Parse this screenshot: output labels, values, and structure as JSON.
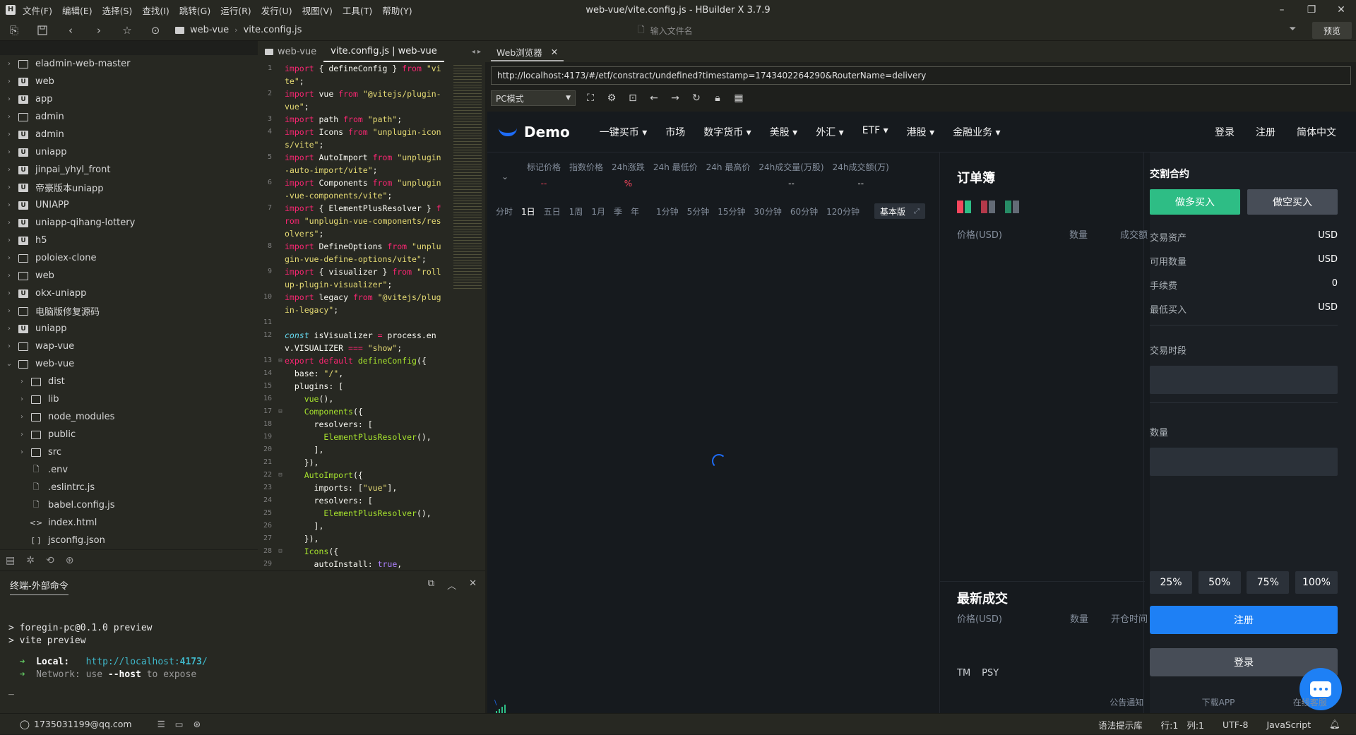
{
  "titlebar": {
    "logo": "H",
    "menu": [
      "文件(F)",
      "编辑(E)",
      "选择(S)",
      "查找(I)",
      "跳转(G)",
      "运行(R)",
      "发行(U)",
      "视图(V)",
      "工具(T)",
      "帮助(Y)"
    ],
    "title": "web-vue/vite.config.js - HBuilder X 3.7.9",
    "controls": {
      "minimize": "–",
      "restore": "❐",
      "close": "✕"
    }
  },
  "toolbar": {
    "breadcrumb": [
      "web-vue",
      "vite.config.js"
    ],
    "file_search_placeholder": "输入文件名",
    "preview_label": "预览"
  },
  "tree": {
    "items": [
      {
        "label": "eladmin-web-master",
        "type": "folder",
        "depth": 0,
        "expanded": false
      },
      {
        "label": "web",
        "type": "project",
        "depth": 0,
        "expanded": false
      },
      {
        "label": "app",
        "type": "project",
        "depth": 0,
        "expanded": false
      },
      {
        "label": "admin",
        "type": "folder",
        "depth": 0,
        "expanded": false
      },
      {
        "label": "admin",
        "type": "project",
        "depth": 0,
        "expanded": false
      },
      {
        "label": "uniapp",
        "type": "project",
        "depth": 0,
        "expanded": false
      },
      {
        "label": "jinpai_yhyl_front",
        "type": "project",
        "depth": 0,
        "expanded": false
      },
      {
        "label": "帝豪版本uniapp",
        "type": "project",
        "depth": 0,
        "expanded": false
      },
      {
        "label": "UNIAPP",
        "type": "project",
        "depth": 0,
        "expanded": false
      },
      {
        "label": "uniapp-qihang-lottery",
        "type": "project",
        "depth": 0,
        "expanded": false
      },
      {
        "label": "h5",
        "type": "project",
        "depth": 0,
        "expanded": false
      },
      {
        "label": "poloiex-clone",
        "type": "folder",
        "depth": 0,
        "expanded": false
      },
      {
        "label": "web",
        "type": "folder",
        "depth": 0,
        "expanded": false
      },
      {
        "label": "okx-uniapp",
        "type": "project",
        "depth": 0,
        "expanded": false
      },
      {
        "label": "电脑版修复源码",
        "type": "folder",
        "depth": 0,
        "expanded": false
      },
      {
        "label": "uniapp",
        "type": "project",
        "depth": 0,
        "expanded": false
      },
      {
        "label": "wap-vue",
        "type": "folder",
        "depth": 0,
        "expanded": false
      },
      {
        "label": "web-vue",
        "type": "folder",
        "depth": 0,
        "expanded": true
      },
      {
        "label": "dist",
        "type": "folder",
        "depth": 1,
        "expanded": false
      },
      {
        "label": "lib",
        "type": "folder",
        "depth": 1,
        "expanded": false
      },
      {
        "label": "node_modules",
        "type": "folder",
        "depth": 1,
        "expanded": false
      },
      {
        "label": "public",
        "type": "folder",
        "depth": 1,
        "expanded": false
      },
      {
        "label": "src",
        "type": "folder",
        "depth": 1,
        "expanded": false
      },
      {
        "label": ".env",
        "type": "file",
        "depth": 1
      },
      {
        "label": ".eslintrc.js",
        "type": "file",
        "depth": 1
      },
      {
        "label": "babel.config.js",
        "type": "file",
        "depth": 1
      },
      {
        "label": "index.html",
        "type": "html",
        "depth": 1
      },
      {
        "label": "jsconfig.json",
        "type": "json",
        "depth": 1
      }
    ]
  },
  "editor": {
    "tabs": [
      {
        "label": "web-vue",
        "active": false
      },
      {
        "label": "vite.config.js | web-vue",
        "active": true
      }
    ],
    "lines": [
      {
        "n": "1",
        "fold": "",
        "html": "<span class=\"kw\">import</span> { defineConfig } <span class=\"kw\">from</span> <span class=\"str\">\"vite\"</span>;"
      },
      {
        "n": "2",
        "fold": "",
        "html": "<span class=\"kw\">import</span> vue <span class=\"kw\">from</span> <span class=\"str\">\"@vitejs/plugin-vue\"</span>;"
      },
      {
        "n": "3",
        "fold": "",
        "html": "<span class=\"kw\">import</span> path <span class=\"kw\">from</span> <span class=\"str\">\"path\"</span>;"
      },
      {
        "n": "4",
        "fold": "",
        "html": "<span class=\"kw\">import</span> Icons <span class=\"kw\">from</span> <span class=\"str\">\"unplugin-icons/vite\"</span>;"
      },
      {
        "n": "5",
        "fold": "",
        "html": "<span class=\"kw\">import</span> AutoImport <span class=\"kw\">from</span> <span class=\"str\">\"unplugin-auto-import/vite\"</span>;"
      },
      {
        "n": "6",
        "fold": "",
        "html": "<span class=\"kw\">import</span> Components <span class=\"kw\">from</span> <span class=\"str\">\"unplugin-vue-components/vite\"</span>;"
      },
      {
        "n": "7",
        "fold": "",
        "html": "<span class=\"kw\">import</span> { ElementPlusResolver } <span class=\"kw\">from</span> <span class=\"str\">\"unplugin-vue-components/resolvers\"</span>;"
      },
      {
        "n": "8",
        "fold": "",
        "html": "<span class=\"kw\">import</span> DefineOptions <span class=\"kw\">from</span> <span class=\"str\">\"unplugin-vue-define-options/vite\"</span>;"
      },
      {
        "n": "9",
        "fold": "",
        "html": "<span class=\"kw\">import</span> { visualizer } <span class=\"kw\">from</span> <span class=\"str\">\"rollup-plugin-visualizer\"</span>;"
      },
      {
        "n": "10",
        "fold": "",
        "html": "<span class=\"kw\">import</span> legacy <span class=\"kw\">from</span> <span class=\"str\">\"@vitejs/plugin-legacy\"</span>;"
      },
      {
        "n": "11",
        "fold": "",
        "html": ""
      },
      {
        "n": "12",
        "fold": "",
        "html": "<span class=\"it\">const</span> isVisualizer <span class=\"kw\">=</span> process.env.VISUALIZER <span class=\"kw\">===</span> <span class=\"str\">\"show\"</span>;"
      },
      {
        "n": "13",
        "fold": "⊟",
        "html": "<span class=\"kw\">export default</span> <span class=\"fn\">defineConfig</span>({"
      },
      {
        "n": "14",
        "fold": "",
        "html": "  base: <span class=\"str\">\"/\"</span>,"
      },
      {
        "n": "15",
        "fold": "",
        "html": "  plugins: ["
      },
      {
        "n": "16",
        "fold": "",
        "html": "    <span class=\"fn\">vue</span>(),"
      },
      {
        "n": "17",
        "fold": "⊟",
        "html": "    <span class=\"fn\">Components</span>({"
      },
      {
        "n": "18",
        "fold": "",
        "html": "      resolvers: ["
      },
      {
        "n": "19",
        "fold": "",
        "html": "        <span class=\"fn\">ElementPlusResolver</span>(),"
      },
      {
        "n": "20",
        "fold": "",
        "html": "      ],"
      },
      {
        "n": "21",
        "fold": "",
        "html": "    }),"
      },
      {
        "n": "22",
        "fold": "⊟",
        "html": "    <span class=\"fn\">AutoImport</span>({"
      },
      {
        "n": "23",
        "fold": "",
        "html": "      imports: [<span class=\"str\">\"vue\"</span>],"
      },
      {
        "n": "24",
        "fold": "",
        "html": "      resolvers: ["
      },
      {
        "n": "25",
        "fold": "",
        "html": "        <span class=\"fn\">ElementPlusResolver</span>(),"
      },
      {
        "n": "26",
        "fold": "",
        "html": "      ],"
      },
      {
        "n": "27",
        "fold": "",
        "html": "    }),"
      },
      {
        "n": "28",
        "fold": "⊟",
        "html": "    <span class=\"fn\">Icons</span>({"
      },
      {
        "n": "29",
        "fold": "",
        "html": "      autoInstall: <span class=\"nb\">true</span>,"
      }
    ]
  },
  "terminal": {
    "tab_label": "终端-外部命令",
    "lines": [
      "> foregin-pc@0.1.0 preview",
      "> vite preview"
    ],
    "local_label": "Local:",
    "local_url_prefix": "http://localhost:",
    "local_port": "4173",
    "local_url_suffix": "/",
    "network_label": "Network:",
    "network_pre": "use",
    "network_flag": "--host",
    "network_post": "to expose",
    "cursor": "_"
  },
  "browser": {
    "tab_label": "Web浏览器",
    "url": "http://localhost:4173/#/etf/constract/undefined?timestamp=1743402264290&RouterName=delivery",
    "mode": "PC模式"
  },
  "site": {
    "logo_text": "Demo",
    "nav": [
      "一键买币 ▾",
      "市场",
      "数字货币 ▾",
      "美股 ▾",
      "外汇 ▾",
      "ETF ▾",
      "港股 ▾",
      "金融业务 ▾"
    ],
    "nav_right": [
      "登录",
      "注册",
      "简体中文"
    ],
    "ticker": [
      {
        "label": "标记价格",
        "value": "--",
        "red": true
      },
      {
        "label": "指数价格",
        "value": "",
        "red": false
      },
      {
        "label": "24h涨跌",
        "value": "%",
        "red": true
      },
      {
        "label": "24h 最低价",
        "value": "",
        "red": false
      },
      {
        "label": "24h 最高价",
        "value": "",
        "red": false
      },
      {
        "label": "24h成交量(万股)",
        "value": "--",
        "red": false
      },
      {
        "label": "24h成交额(万)",
        "value": "--",
        "red": false
      }
    ],
    "timeframes": [
      "分时",
      "1日",
      "五日",
      "1周",
      "1月",
      "季",
      "年",
      "1分钟",
      "5分钟",
      "15分钟",
      "30分钟",
      "60分钟",
      "120分钟"
    ],
    "active_timeframe": "1日",
    "basic_label": "基本版",
    "orderbook": {
      "title": "订单簿",
      "headers": [
        "价格(USD)",
        "数量",
        "成交额"
      ],
      "latest_title": "最新成交",
      "latest_headers": [
        "价格(USD)",
        "数量",
        "开仓时间"
      ],
      "indicators": [
        "TM",
        "PSY"
      ]
    },
    "trade": {
      "title": "交割合约",
      "buy_long": "做多买入",
      "buy_short": "做空买入",
      "rows": [
        {
          "label": "交易资产",
          "value": "USD"
        },
        {
          "label": "可用数量",
          "value": "USD"
        },
        {
          "label": "手续费",
          "value": "0"
        },
        {
          "label": "最低买入",
          "value": "USD"
        }
      ],
      "period_label": "交易时段",
      "quantity_label": "数量",
      "percents": [
        "25%",
        "50%",
        "75%",
        "100%"
      ],
      "register": "注册",
      "login": "登录"
    },
    "footer_links": [
      "公告通知",
      "下载APP",
      "在线客服"
    ],
    "colors": {
      "green": "#2ebd85",
      "blue": "#1e80f5",
      "red": "#f6465d"
    }
  },
  "statusbar": {
    "user": "1735031199@qq.com",
    "right": [
      "语法提示库",
      "行:1",
      "列:1",
      "UTF-8",
      "JavaScript"
    ]
  }
}
